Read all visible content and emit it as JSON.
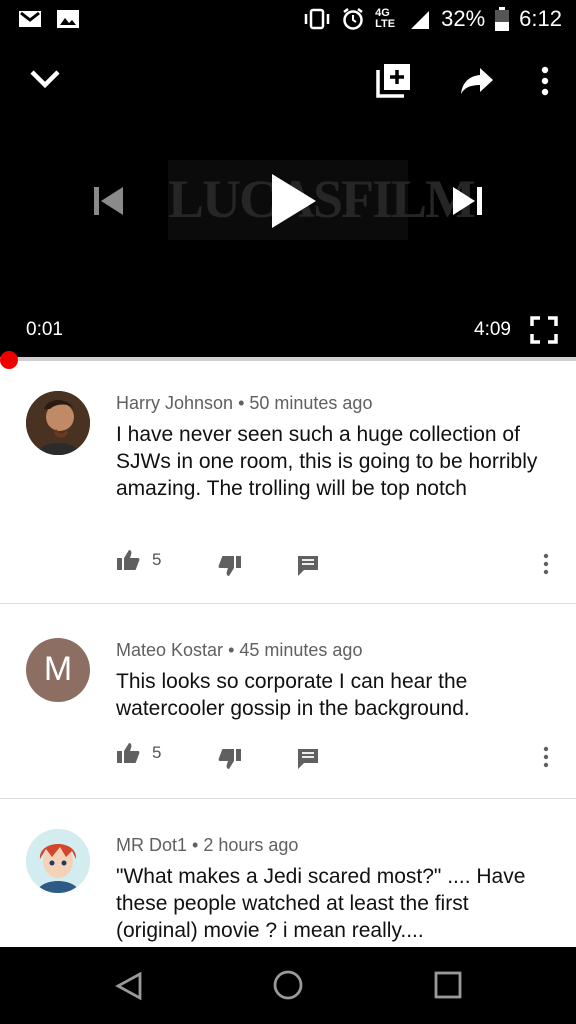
{
  "status_bar": {
    "network": "4G LTE",
    "battery": "32%",
    "time": "6:12",
    "icons": [
      "gmail-icon",
      "image-icon",
      "vibrate-icon",
      "alarm-icon",
      "signal-icon",
      "battery-icon"
    ]
  },
  "player": {
    "current_time": "0:01",
    "duration": "4:09",
    "progress_fraction": 0.004,
    "thumbnail_text": "LUCASFILM"
  },
  "comments": [
    {
      "author": "Harry Johnson",
      "age": "50 minutes ago",
      "text": "I have never seen such a huge collection of SJWs in one room, this is going to be horribly amazing. The trolling will be top notch",
      "likes": "5",
      "avatar_initial": ""
    },
    {
      "author": "Mateo Kostar",
      "age": "45 minutes ago",
      "text": "This looks so corporate I can hear the watercooler gossip in the background.",
      "likes": "5",
      "avatar_initial": "M"
    },
    {
      "author": "MR Dot1",
      "age": "2 hours ago",
      "text": "\"What makes a Jedi scared most?\" .... Have these people watched at least the first (original) movie ? i mean really....",
      "likes": "",
      "avatar_initial": ""
    }
  ],
  "separator": " • ",
  "colors": {
    "progress": "#ff0000",
    "avatar_m": "#8d6e63"
  }
}
